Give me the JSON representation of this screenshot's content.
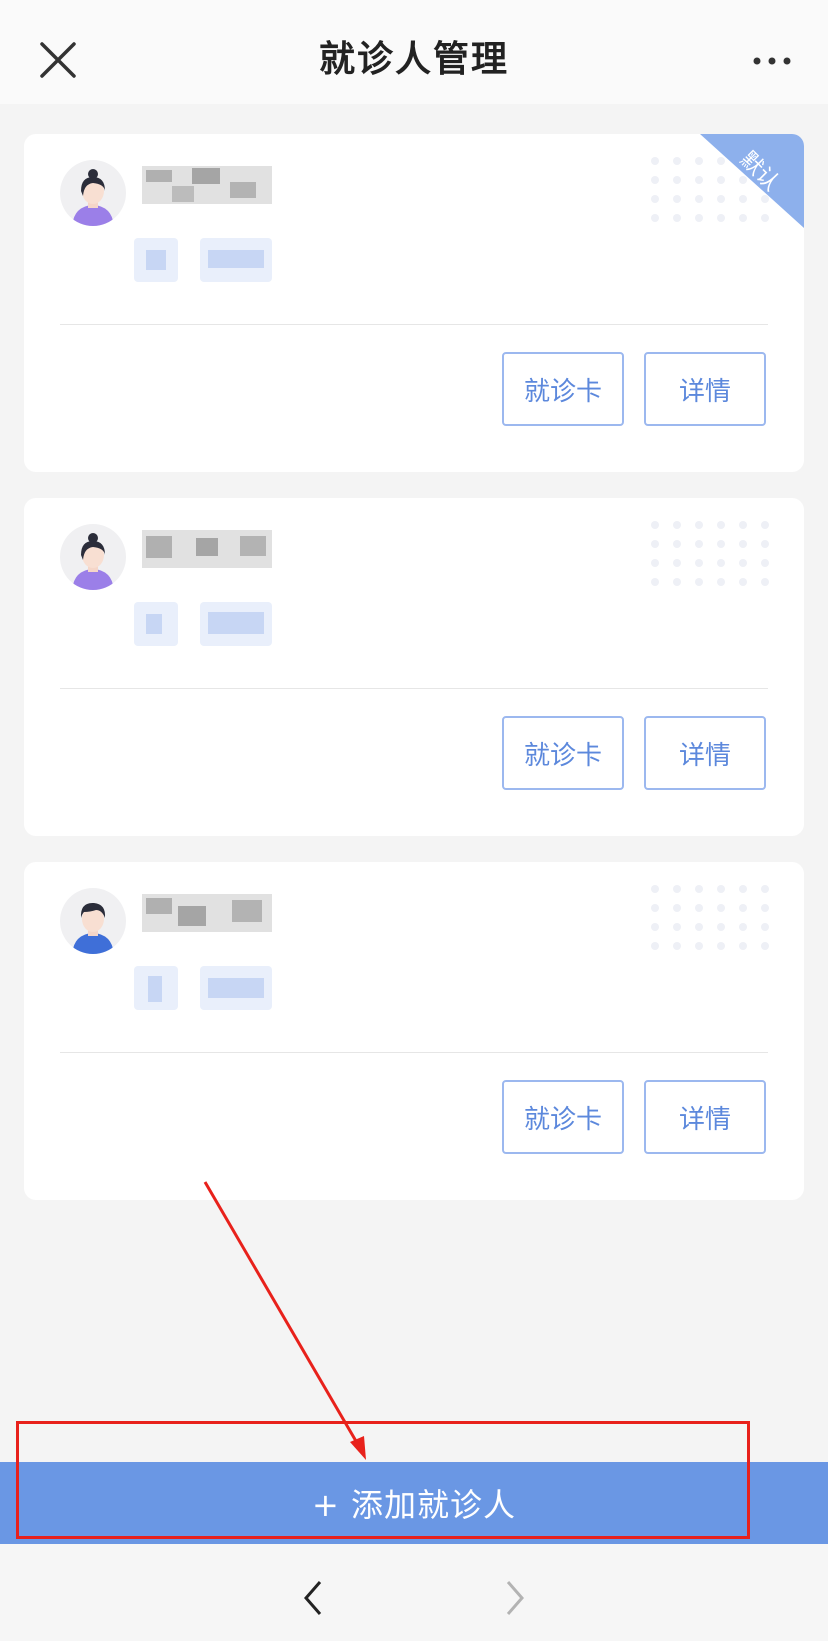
{
  "header": {
    "title": "就诊人管理"
  },
  "cards": [
    {
      "badge": "默认",
      "card_button": "就诊卡",
      "detail_button": "详情",
      "avatar": "female-avatar-icon"
    },
    {
      "card_button": "就诊卡",
      "detail_button": "详情",
      "avatar": "female-avatar-icon"
    },
    {
      "card_button": "就诊卡",
      "detail_button": "详情",
      "avatar": "male-avatar-icon"
    }
  ],
  "footer": {
    "add_label": "+ 添加就诊人"
  },
  "colors": {
    "accent": "#6a97e4",
    "button_text": "#5c88dc",
    "annotation": "#e8211b"
  }
}
